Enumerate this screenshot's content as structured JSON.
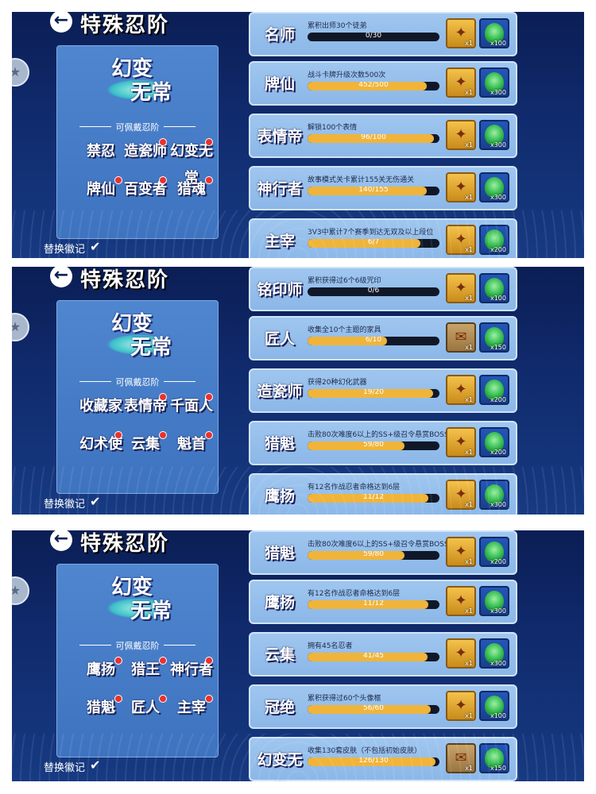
{
  "panels": [
    {
      "title": "特殊忍阶",
      "badge_chars": [
        "幻变",
        "无常"
      ],
      "equip_label": "可佩戴忍阶",
      "replace_label": "替换徽记",
      "slots": [
        {
          "label": "禁忍",
          "dot": false
        },
        {
          "label": "造瓷师",
          "dot": true
        },
        {
          "label": "幻变无常",
          "dot": true
        },
        {
          "label": "牌仙",
          "dot": true
        },
        {
          "label": "百变者",
          "dot": true
        },
        {
          "label": "猎魂",
          "dot": true
        }
      ],
      "rows": [
        {
          "emblem": "名师",
          "desc": "累积出师30个徒弟",
          "progress_text": "0/30",
          "progress": 0,
          "reward1": "gold",
          "reward1_count": "x1",
          "reward2_count": "x100"
        },
        {
          "emblem": "牌仙",
          "desc": "战斗卡牌升级次数500次",
          "progress_text": "452/500",
          "progress": 0.904,
          "reward1": "gold",
          "reward1_count": "x1",
          "reward2_count": "x300"
        },
        {
          "emblem": "表情帝",
          "desc": "解锁100个表情",
          "progress_text": "96/100",
          "progress": 0.96,
          "reward1": "gold",
          "reward1_count": "x1",
          "reward2_count": "x300"
        },
        {
          "emblem": "神行者",
          "desc": "故事模式关卡累计155关无伤通关",
          "progress_text": "140/155",
          "progress": 0.903,
          "reward1": "gold",
          "reward1_count": "x1",
          "reward2_count": "x300"
        },
        {
          "emblem": "主宰",
          "desc": "3V3中累计7个赛季到达无双及以上段位",
          "progress_text": "6/7",
          "progress": 0.857,
          "reward1": "gold",
          "reward1_count": "x1",
          "reward2_count": "x200"
        }
      ]
    },
    {
      "title": "特殊忍阶",
      "badge_chars": [
        "幻变",
        "无常"
      ],
      "equip_label": "可佩戴忍阶",
      "replace_label": "替换徽记",
      "slots": [
        {
          "label": "收藏家",
          "dot": false
        },
        {
          "label": "表情帝",
          "dot": true
        },
        {
          "label": "千面人",
          "dot": true
        },
        {
          "label": "幻术使",
          "dot": true
        },
        {
          "label": "云集",
          "dot": true
        },
        {
          "label": "魁首",
          "dot": true
        }
      ],
      "rows": [
        {
          "emblem": "铭印师",
          "desc": "累积获得过6个6级咒印",
          "progress_text": "0/6",
          "progress": 0,
          "reward1": "gold",
          "reward1_count": "x1",
          "reward2_count": "x100"
        },
        {
          "emblem": "匠人",
          "desc": "收集全10个主题的家具",
          "progress_text": "6/10",
          "progress": 0.6,
          "reward1": "scroll",
          "reward1_count": "x1",
          "reward2_count": "x150"
        },
        {
          "emblem": "造瓷师",
          "desc": "获得20种幻化武器",
          "progress_text": "19/20",
          "progress": 0.95,
          "reward1": "gold",
          "reward1_count": "x1",
          "reward2_count": "x200"
        },
        {
          "emblem": "猎魁",
          "desc": "击败80次难度6以上的SS+级召令悬赏BOSS",
          "progress_text": "59/80",
          "progress": 0.7375,
          "reward1": "gold",
          "reward1_count": "x1",
          "reward2_count": "x200"
        },
        {
          "emblem": "鹰扬",
          "desc": "有12名作战忍者命格达到6层",
          "progress_text": "11/12",
          "progress": 0.9167,
          "reward1": "gold",
          "reward1_count": "x1",
          "reward2_count": "x300"
        }
      ]
    },
    {
      "title": "特殊忍阶",
      "badge_chars": [
        "幻变",
        "无常"
      ],
      "equip_label": "可佩戴忍阶",
      "replace_label": "替换徽记",
      "slots": [
        {
          "label": "鹰扬",
          "dot": true
        },
        {
          "label": "猎王",
          "dot": true
        },
        {
          "label": "神行者",
          "dot": true
        },
        {
          "label": "猎魁",
          "dot": true
        },
        {
          "label": "匠人",
          "dot": true
        },
        {
          "label": "主宰",
          "dot": true
        }
      ],
      "rows": [
        {
          "emblem": "猎魁",
          "desc": "击败80次难度6以上的SS+级召令悬赏BOSS",
          "progress_text": "59/80",
          "progress": 0.7375,
          "reward1": "gold",
          "reward1_count": "x1",
          "reward2_count": "x200"
        },
        {
          "emblem": "鹰扬",
          "desc": "有12名作战忍者命格达到6层",
          "progress_text": "11/12",
          "progress": 0.9167,
          "reward1": "gold",
          "reward1_count": "x1",
          "reward2_count": "x300"
        },
        {
          "emblem": "云集",
          "desc": "拥有45名忍者",
          "progress_text": "41/45",
          "progress": 0.911,
          "reward1": "gold",
          "reward1_count": "x1",
          "reward2_count": "x300"
        },
        {
          "emblem": "冠绝",
          "desc": "累积获得过60个头像框",
          "progress_text": "56/60",
          "progress": 0.933,
          "reward1": "gold",
          "reward1_count": "x1",
          "reward2_count": "x100"
        },
        {
          "emblem": "幻变无常",
          "desc": "收集130套皮肤（不包括初始皮肤）",
          "progress_text": "126/130",
          "progress": 0.969,
          "reward1": "scroll",
          "reward1_count": "x1",
          "reward2_count": "x150"
        }
      ]
    }
  ],
  "icons": {
    "back": "arrow-left-icon",
    "side": "star-icon",
    "check": "checkmark-icon",
    "reward_gold": "scroll-gold-icon",
    "reward_scroll": "scroll-paper-icon",
    "reward_blue": "green-orb-icon"
  },
  "colors": {
    "background": "#102a6c",
    "card": "#4f86cf",
    "row": "#9fc6ef",
    "bar_fill": "#f0b43a",
    "bar_track": "#101828",
    "dot": "#e8322f"
  }
}
